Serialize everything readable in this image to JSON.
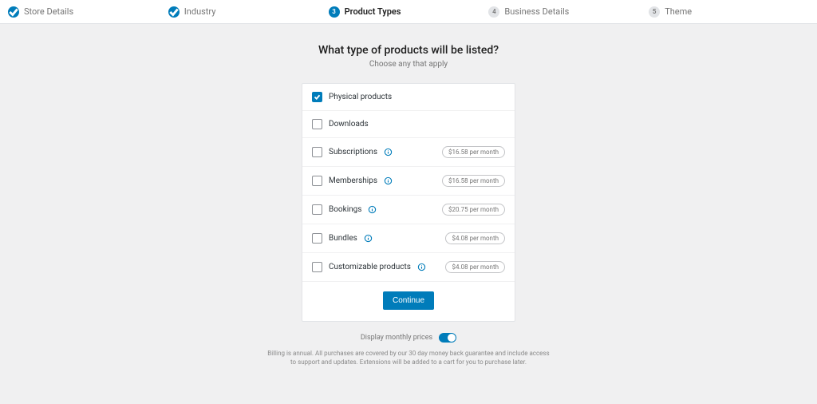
{
  "stepper": {
    "steps": [
      {
        "label": "Store Details",
        "state": "checked"
      },
      {
        "label": "Industry",
        "state": "checked"
      },
      {
        "label": "Product Types",
        "state": "current",
        "num": "3"
      },
      {
        "label": "Business Details",
        "state": "pending",
        "num": "4"
      },
      {
        "label": "Theme",
        "state": "pending",
        "num": "5"
      }
    ]
  },
  "header": {
    "title": "What type of products will be listed?",
    "subtitle": "Choose any that apply"
  },
  "options": [
    {
      "label": "Physical products",
      "checked": true,
      "info": false,
      "price": null
    },
    {
      "label": "Downloads",
      "checked": false,
      "info": false,
      "price": null
    },
    {
      "label": "Subscriptions",
      "checked": false,
      "info": true,
      "price": "$16.58 per month"
    },
    {
      "label": "Memberships",
      "checked": false,
      "info": true,
      "price": "$16.58 per month"
    },
    {
      "label": "Bookings",
      "checked": false,
      "info": true,
      "price": "$20.75 per month"
    },
    {
      "label": "Bundles",
      "checked": false,
      "info": true,
      "price": "$4.08 per month"
    },
    {
      "label": "Customizable products",
      "checked": false,
      "info": true,
      "price": "$4.08 per month"
    }
  ],
  "continue_label": "Continue",
  "footer": {
    "toggle_label": "Display monthly prices",
    "disclaimer": "Billing is annual. All purchases are covered by our 30 day money back guarantee and include access to support and updates. Extensions will be added to a cart for you to purchase later."
  }
}
